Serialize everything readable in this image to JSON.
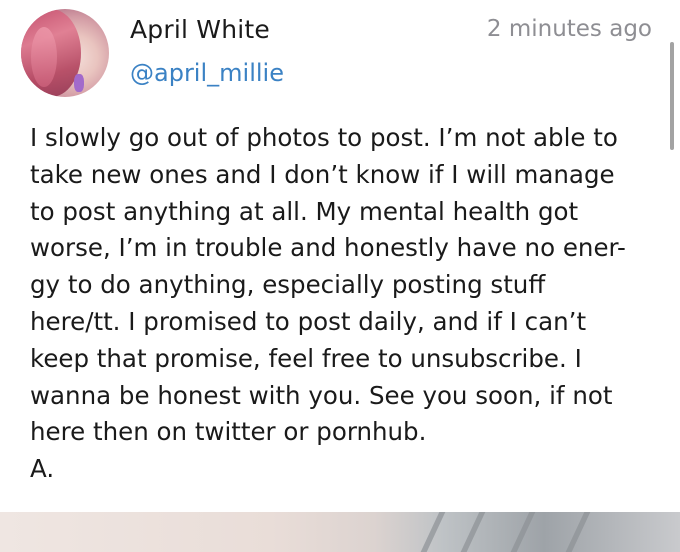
{
  "post": {
    "author": {
      "name": "April White",
      "handle": "@april_millie",
      "avatar": "avatar-photo"
    },
    "timestamp": "2 minutes ago",
    "text": "I slowly go out of photos to post. I’m not able to\ntake new ones and I don’t know if I will manage\nto post anything at all. My mental health got\nworse, I’m in trouble and honestly have no ener-\ngy to do anything, especially posting stuff\nhere/tt. I promised to post daily, and if I can’t\nkeep that promise, feel free to unsubscribe. I\nwanna be honest with you. See you soon, if not\nhere then on twitter or pornhub.\nA.",
    "attachment": "photo"
  },
  "colors": {
    "handle": "#3b82c4",
    "text": "#1a1a1a",
    "timestamp": "#8e8e93",
    "background": "#ffffff"
  }
}
